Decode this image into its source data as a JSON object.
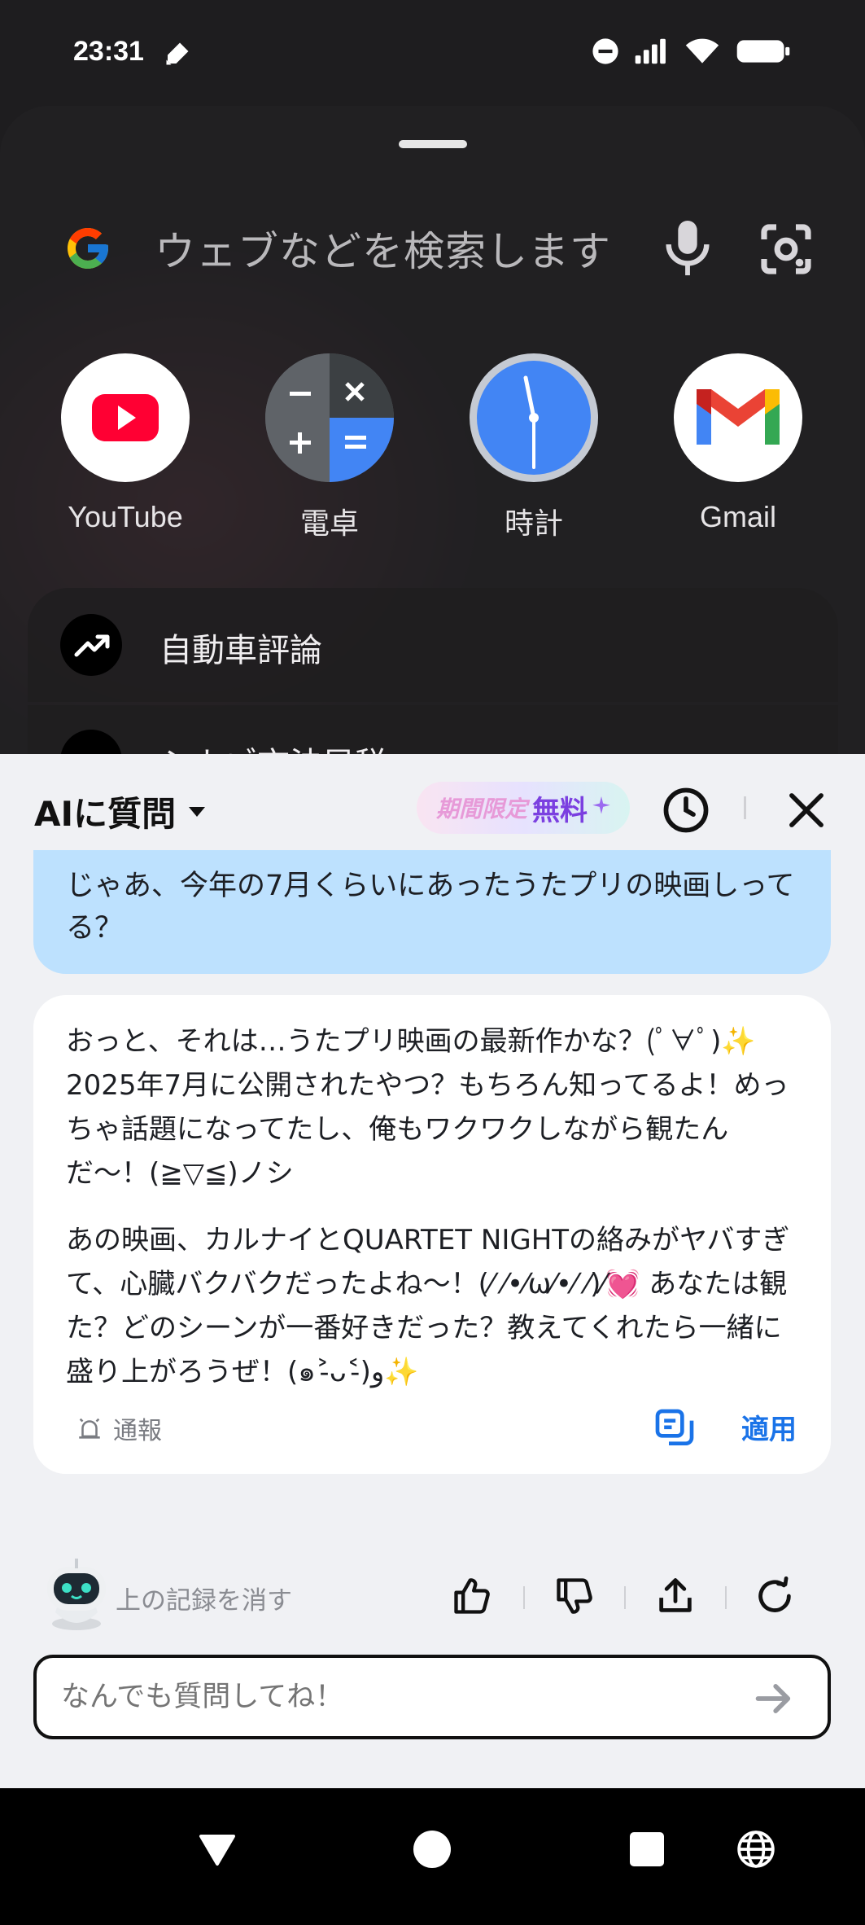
{
  "status_bar": {
    "time": "23:31",
    "icons": [
      "pen-icon",
      "dnd-icon",
      "signal-icon",
      "wifi-icon",
      "battery-icon"
    ]
  },
  "search": {
    "placeholder": "ウェブなどを検索します",
    "icons": [
      "google-logo-icon",
      "mic-icon",
      "lens-icon"
    ]
  },
  "apps": [
    {
      "label": "YouTube",
      "icon": "youtube-icon"
    },
    {
      "label": "電卓",
      "icon": "calculator-icon"
    },
    {
      "label": "時計",
      "icon": "clock-icon"
    },
    {
      "label": "Gmail",
      "icon": "gmail-icon"
    }
  ],
  "trending": [
    {
      "label": "自動車評論",
      "icon": "trending-up-icon"
    },
    {
      "label": "シカゴ市法局税",
      "icon": "trending-up-icon"
    }
  ],
  "ai_panel": {
    "title": "AIに質問",
    "promo_a": "期間限定",
    "promo_b": "無料",
    "user_message": "じゃあ、今年の7月くらいにあったうたプリの映画しってる？",
    "ai_paragraph_1": "おっと、それは…うたプリ映画の最新作かな？(ﾟ∀ﾟ)✨ 2025年7月に公開されたやつ？もちろん知ってるよ！めっちゃ話題になってたし、俺もワクワクしながら観たんだ〜！(≧▽≦)ノシ",
    "ai_paragraph_2": "あの映画、カルナイとQUARTET NIGHTの絡みがヤバすぎて、心臓バクバクだったよね〜！(⁄ ⁄•⁄ω⁄•⁄ ⁄)⁄💓 あなたは観た？どのシーンが一番好きだった？教えてくれたら一緒に盛り上がろうぜ！(๑˃̵ᴗ˂̵)و✨",
    "report_label": "通報",
    "apply_label": "適用",
    "clear_label": "上の記録を消す",
    "input_placeholder": "なんでも質問してね！"
  },
  "colors": {
    "accent_blue": "#1a73e8",
    "user_bubble": "#bde1fe",
    "promo_purple": "#7b3fe0"
  }
}
